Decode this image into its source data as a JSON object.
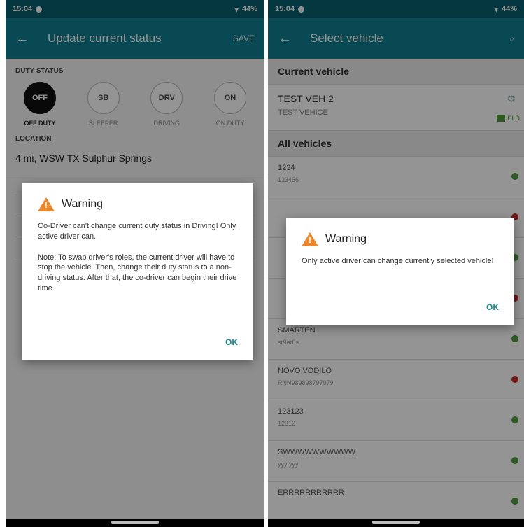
{
  "left": {
    "status": {
      "time": "15:04",
      "battery": "44%"
    },
    "appbar": {
      "title": "Update current status",
      "action": "SAVE"
    },
    "duty_section_label": "DUTY STATUS",
    "duty_statuses": [
      {
        "code": "OFF",
        "label": "OFF DUTY",
        "active": true
      },
      {
        "code": "SB",
        "label": "SLEEPER",
        "active": false
      },
      {
        "code": "DRV",
        "label": "DRIVING",
        "active": false
      },
      {
        "code": "ON",
        "label": "ON DUTY",
        "active": false
      }
    ],
    "location_label": "LOCATION",
    "location_value": "4 mi, WSW TX Sulphur Springs",
    "dialog": {
      "title": "Warning",
      "body": "Co-Driver can't change current duty status in Driving! Only active driver can.\n\nNote: To swap driver's roles, the current driver will have to stop the vehicle. Then, change their duty status to a non-driving status. After that, the co-driver can begin their drive time.",
      "ok_label": "OK"
    }
  },
  "right": {
    "status": {
      "time": "15:04",
      "battery": "44%"
    },
    "appbar": {
      "title": "Select vehicle"
    },
    "current_header": "Current vehicle",
    "current_vehicle": {
      "name": "TEST VEH 2",
      "sub": "TEST VEHICE",
      "badge": "ELD"
    },
    "all_header": "All vehicles",
    "vehicles": [
      {
        "name": "1234",
        "sub": "123456",
        "dot": "#4a9a3a"
      },
      {
        "name": "",
        "sub": "",
        "dot": "#c62828"
      },
      {
        "name": "",
        "sub": "",
        "dot": "#4a9a3a"
      },
      {
        "name": "",
        "sub": "",
        "dot": "#c62828"
      },
      {
        "name": "SMARTEN",
        "sub": "sr9ar8s",
        "dot": "#4a9a3a"
      },
      {
        "name": "NOVO VODILO",
        "sub": "RNN989898797979",
        "dot": "#c62828"
      },
      {
        "name": "123123",
        "sub": "12312",
        "dot": "#4a9a3a"
      },
      {
        "name": "SWWWWWWWWWW",
        "sub": "yyy yyy",
        "dot": "#4a9a3a"
      },
      {
        "name": "ERRRRRRRRRRR",
        "sub": "",
        "dot": "#4a9a3a"
      }
    ],
    "dialog": {
      "title": "Warning",
      "body": "Only active driver can change currently selected vehicle!",
      "ok_label": "OK"
    }
  }
}
